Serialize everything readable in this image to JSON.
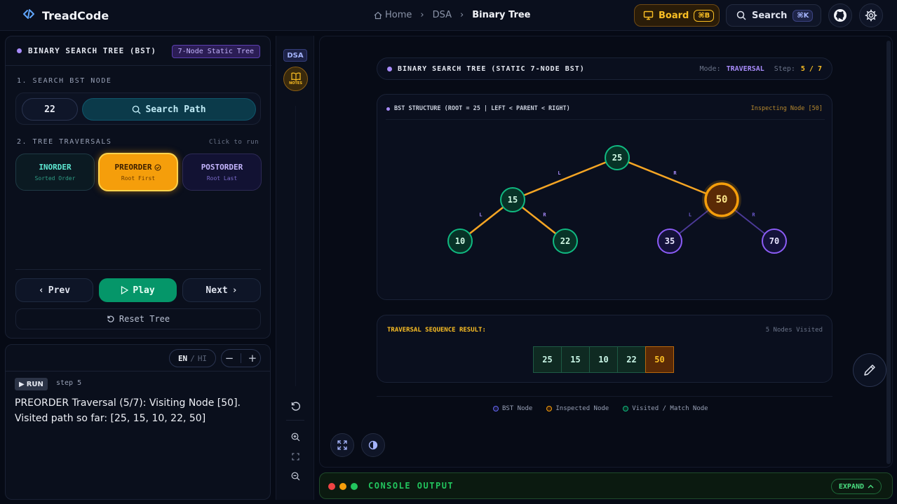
{
  "app": {
    "name": "TreadCode"
  },
  "breadcrumb": {
    "home": "Home",
    "section": "DSA",
    "current": "Binary Tree"
  },
  "header": {
    "board_label": "Board",
    "board_kbd": "⌘B",
    "search_label": "Search",
    "search_kbd": "⌘K"
  },
  "left_panel": {
    "title": "BINARY SEARCH TREE (BST)",
    "badge": "7-Node Static Tree",
    "search_section": "1. SEARCH BST NODE",
    "search_value": "22",
    "search_button": "Search Path",
    "traversal_section": "2. TREE TRAVERSALS",
    "traversal_hint": "Click to run",
    "traversals": [
      {
        "label": "INORDER",
        "sub": "Sorted Order"
      },
      {
        "label": "PREORDER",
        "sub": "Root First"
      },
      {
        "label": "POSTORDER",
        "sub": "Root Last"
      }
    ],
    "prev": "Prev",
    "play": "Play",
    "next": "Next",
    "reset": "Reset Tree"
  },
  "notes_panel": {
    "lang_en": "EN",
    "lang_sep": "/",
    "lang_hi": "HI",
    "zoom_minus": "−",
    "zoom_plus": "+",
    "run_badge": "RUN",
    "step": "step 5",
    "message": "PREORDER Traversal (5/7): Visiting Node [50]. Visited path so far: [25, 15, 10, 22, 50]"
  },
  "rail": {
    "dsa": "DSA",
    "notes": "NOTES"
  },
  "visualizer": {
    "title": "BINARY SEARCH TREE (STATIC 7-NODE BST)",
    "mode_label": "Mode:",
    "mode_value": "TRAVERSAL",
    "step_label": "Step:",
    "step_value": "5 / 7",
    "structure_title": "BST STRUCTURE (ROOT = 25 | LEFT < PARENT < RIGHT)",
    "inspecting": "Inspecting Node [50]",
    "tree": {
      "nodes": [
        {
          "value": "25",
          "state": "visited"
        },
        {
          "value": "15",
          "state": "visited"
        },
        {
          "value": "50",
          "state": "inspected"
        },
        {
          "value": "10",
          "state": "visited"
        },
        {
          "value": "22",
          "state": "visited"
        },
        {
          "value": "35",
          "state": "bst"
        },
        {
          "value": "70",
          "state": "bst"
        }
      ],
      "edge_labels": {
        "L": "L",
        "R": "R"
      }
    },
    "result_title": "TRAVERSAL SEQUENCE RESULT:",
    "result_count": "5 Nodes Visited",
    "sequence": [
      "25",
      "15",
      "10",
      "22",
      "50"
    ],
    "legend": {
      "bst": "BST Node",
      "inspected": "Inspected Node",
      "visited": "Visited / Match Node"
    }
  },
  "console": {
    "title": "CONSOLE OUTPUT",
    "expand": "EXPAND"
  },
  "colors": {
    "accent_orange": "#f59e0b",
    "visited_green": "#10b981",
    "bst_purple": "#8b5cf6",
    "inspect_fill": "#5a2a06"
  }
}
